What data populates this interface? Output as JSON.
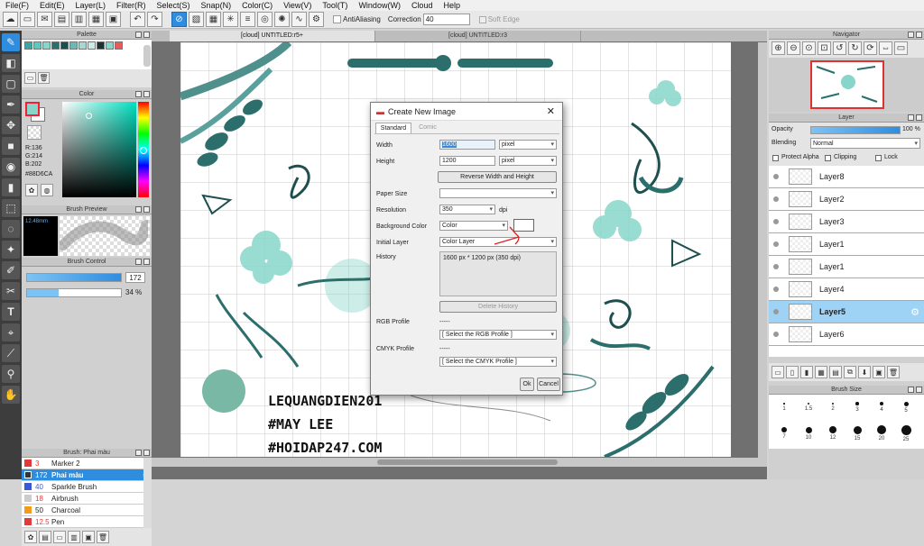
{
  "menu": [
    "File(F)",
    "Edit(E)",
    "Layer(L)",
    "Filter(R)",
    "Select(S)",
    "Snap(N)",
    "Color(C)",
    "View(V)",
    "Tool(T)",
    "Window(W)",
    "Cloud",
    "Help"
  ],
  "toolbar": {
    "antialias_label": "AntiAliasing",
    "correction_label": "Correction",
    "correction_value": "40",
    "softedge_label": "Soft Edge"
  },
  "tabs": [
    "[cloud] UNTITLED:r5+",
    "[cloud] UNTITLED:r3"
  ],
  "palette": {
    "title": "Palette",
    "colors": [
      "#3aa7a0",
      "#5cc9c1",
      "#88d6ca",
      "#2b6e6b",
      "#1e4f4f",
      "#6bb9b3",
      "#a7d8d3",
      "#cfe9e7",
      "#1d3333",
      "#88D6CA",
      "#e85b5b"
    ]
  },
  "color_panel": {
    "title": "Color",
    "r": "R:136",
    "g": "G:214",
    "b": "B:202",
    "hex": "#88D6CA",
    "fg": "#88D6CA",
    "bg": "#ffffff"
  },
  "brush_preview": {
    "title": "Brush Preview",
    "size": "12.48mm"
  },
  "brush_control": {
    "title": "Brush Control",
    "size_value": "172",
    "opacity_value": "34 %"
  },
  "brush_list": {
    "title": "Brush: Phai màu",
    "items": [
      {
        "size": "3",
        "name": "Marker 2",
        "color": "#e03b3b"
      },
      {
        "size": "172",
        "name": "Phai màu",
        "color": "#333333"
      },
      {
        "size": "40",
        "name": "Sparkle Brush",
        "color": "#3b59d6"
      },
      {
        "size": "18",
        "name": "Airbrush",
        "color": "#cccccc"
      },
      {
        "size": "50",
        "name": "Charcoal",
        "color": "#f39c1a"
      },
      {
        "size": "12.5",
        "name": "Pen",
        "color": "#e03b3b"
      }
    ]
  },
  "navigator": {
    "title": "Navigator"
  },
  "layer_panel": {
    "title": "Layer",
    "opacity_label": "Opacity",
    "opacity_value": "100 %",
    "blending_label": "Blending",
    "blending_value": "Normal",
    "protect_alpha": "Protect Alpha",
    "clipping": "Clipping",
    "lock": "Lock",
    "layers": [
      "Layer8",
      "Layer2",
      "Layer3",
      "Layer1",
      "Layer1",
      "Layer4",
      "Layer5",
      "Layer6"
    ],
    "selected_index": 6
  },
  "brush_size_panel": {
    "title": "Brush Size",
    "sizes_row1": [
      "1",
      "1.5",
      "2",
      "3",
      "4",
      "5"
    ],
    "sizes_row2": [
      "7",
      "10",
      "12",
      "15",
      "20",
      "25"
    ]
  },
  "dialog": {
    "title": "Create New Image",
    "tabs": [
      "Standard",
      "Comic"
    ],
    "width_label": "Width",
    "width_value": "1600",
    "width_unit": "pixel",
    "height_label": "Height",
    "height_value": "1200",
    "height_unit": "pixel",
    "reverse_button": "Reverse Width and Height",
    "paper_size_label": "Paper Size",
    "resolution_label": "Resolution",
    "resolution_value": "350",
    "resolution_unit": "dpi",
    "bgcolor_label": "Background Color",
    "bgcolor_value": "Color",
    "initial_layer_label": "Initial Layer",
    "initial_layer_value": "Color Layer",
    "history_label": "History",
    "history_item": "1600 px * 1200 px (350 dpi)",
    "delete_history_button": "Delete History",
    "rgb_profile_label": "RGB Profile",
    "rgb_profile_dash": "-----",
    "rgb_profile_select": "[ Select the RGB Profile ]",
    "cmyk_profile_label": "CMYK Profile",
    "cmyk_profile_dash": "-----",
    "cmyk_profile_select": "[ Select the CMYK Profile ]",
    "ok_button": "Ok",
    "cancel_button": "Cancel"
  },
  "watermark": {
    "line1": "LEQUANGDIEN201",
    "line2": "#MAY LEE",
    "line3": "#HOIDAP247.COM"
  }
}
